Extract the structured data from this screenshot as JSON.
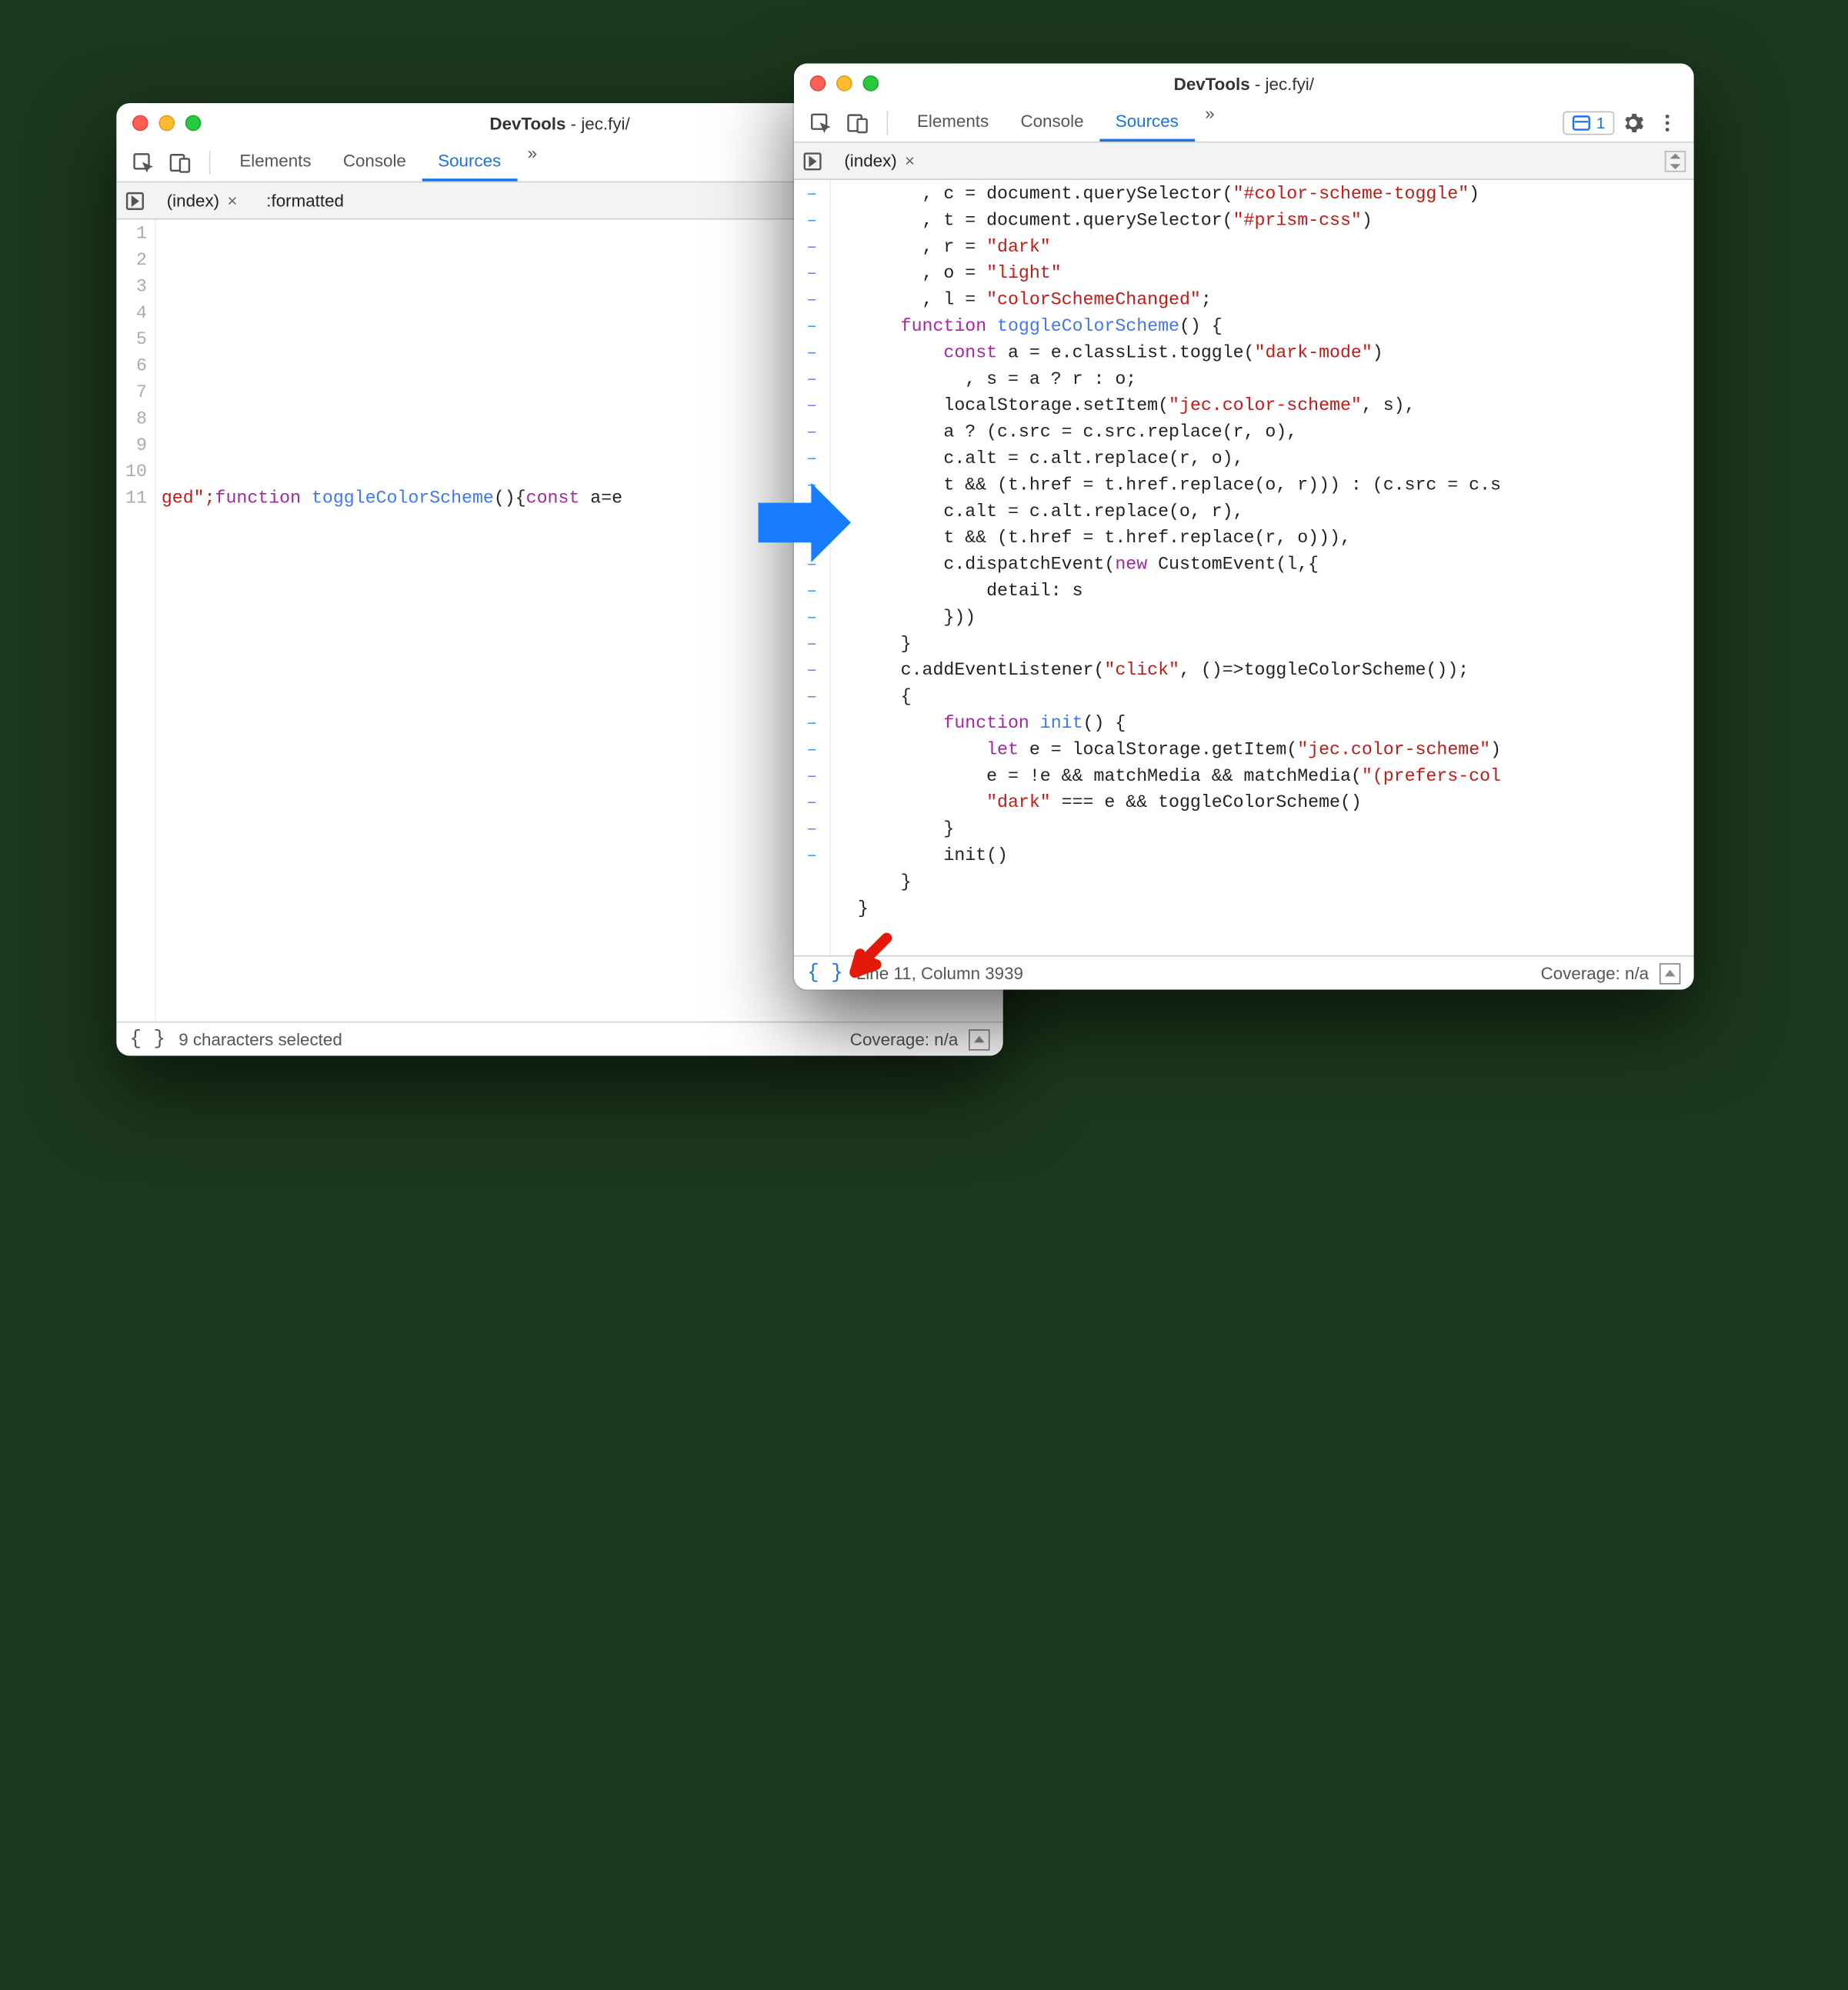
{
  "title_brand": "DevTools",
  "title_site": "jec.fyi/",
  "tabs": {
    "elements": "Elements",
    "console": "Console",
    "sources": "Sources",
    "more": "»"
  },
  "filetab_index": "(index)",
  "filetab_formatted": ":formatted",
  "issues_count": "1",
  "left": {
    "gutter": "1\n2\n3\n4\n5\n6\n7\n8\n9\n10\n11",
    "status_text": "9 characters selected",
    "coverage": "Coverage: n/a"
  },
  "right": {
    "dashes": "–\n–\n–\n–\n–\n–\n–\n–\n–\n–\n–\n–\n–\n–\n–\n–\n–\n–\n–\n–\n–\n–\n–\n–\n–\n–",
    "status_text": "Line 11, Column 3939",
    "coverage": "Coverage: n/a"
  },
  "code_left_prefix": "ged\";",
  "code_left_kw1": "function",
  "code_left_fn": "toggleColorScheme",
  "code_left_open": "(){",
  "code_left_kw2": "const",
  "code_left_rest": " a=e",
  "code_right": {
    "l1": {
      "pre": "        , c = document.querySelector(",
      "str": "\"#color-scheme-toggle\"",
      "post": ")"
    },
    "l2": {
      "pre": "        , t = document.querySelector(",
      "str": "\"#prism-css\"",
      "post": ")"
    },
    "l3": {
      "pre": "        , r = ",
      "str": "\"dark\""
    },
    "l4": {
      "pre": "        , o = ",
      "str": "\"light\""
    },
    "l5": {
      "pre": "        , l = ",
      "str": "\"colorSchemeChanged\"",
      "post": ";"
    },
    "l6": {
      "kw": "function",
      "pre": "      ",
      "fn": " toggleColorScheme",
      "post": "() {"
    },
    "l7": {
      "pre": "          ",
      "kw": "const",
      "mid": " a = e.classList.toggle(",
      "str": "\"dark-mode\"",
      "post": ")"
    },
    "l8": {
      "txt": "            , s = a ? r : o;"
    },
    "l9": {
      "pre": "          localStorage.setItem(",
      "str": "\"jec.color-scheme\"",
      "post": ", s),"
    },
    "l10": {
      "txt": "          a ? (c.src = c.src.replace(r, o),"
    },
    "l11": {
      "txt": "          c.alt = c.alt.replace(r, o),"
    },
    "l12": {
      "txt": "          t && (t.href = t.href.replace(o, r))) : (c.src = c.s"
    },
    "l13": {
      "txt": "          c.alt = c.alt.replace(o, r),"
    },
    "l14": {
      "txt": "          t && (t.href = t.href.replace(r, o))),"
    },
    "l15": {
      "pre": "          c.dispatchEvent(",
      "kw": "new",
      "post": " CustomEvent(l,{"
    },
    "l16": {
      "txt": "              detail: s"
    },
    "l17": {
      "txt": "          }))"
    },
    "l18": {
      "txt": "      }"
    },
    "l19": {
      "pre": "      c.addEventListener(",
      "str": "\"click\"",
      "post": ", ()=>toggleColorScheme());"
    },
    "l20": {
      "txt": "      {"
    },
    "l21": {
      "pre": "          ",
      "kw": "function",
      "fn": " init",
      "post": "() {"
    },
    "l22": {
      "pre": "              ",
      "kw": "let",
      "mid": " e = localStorage.getItem(",
      "str": "\"jec.color-scheme\"",
      "post": ")"
    },
    "l23": {
      "pre": "              e = !e && matchMedia && matchMedia(",
      "str": "\"(prefers-col"
    },
    "l24": {
      "pre": "              ",
      "str": "\"dark\"",
      "post": " === e && toggleColorScheme()"
    },
    "l25": {
      "txt": "          }"
    },
    "l26": {
      "txt": "          init()"
    },
    "l27": {
      "txt": "      }"
    },
    "l28": {
      "txt": "  }"
    }
  }
}
